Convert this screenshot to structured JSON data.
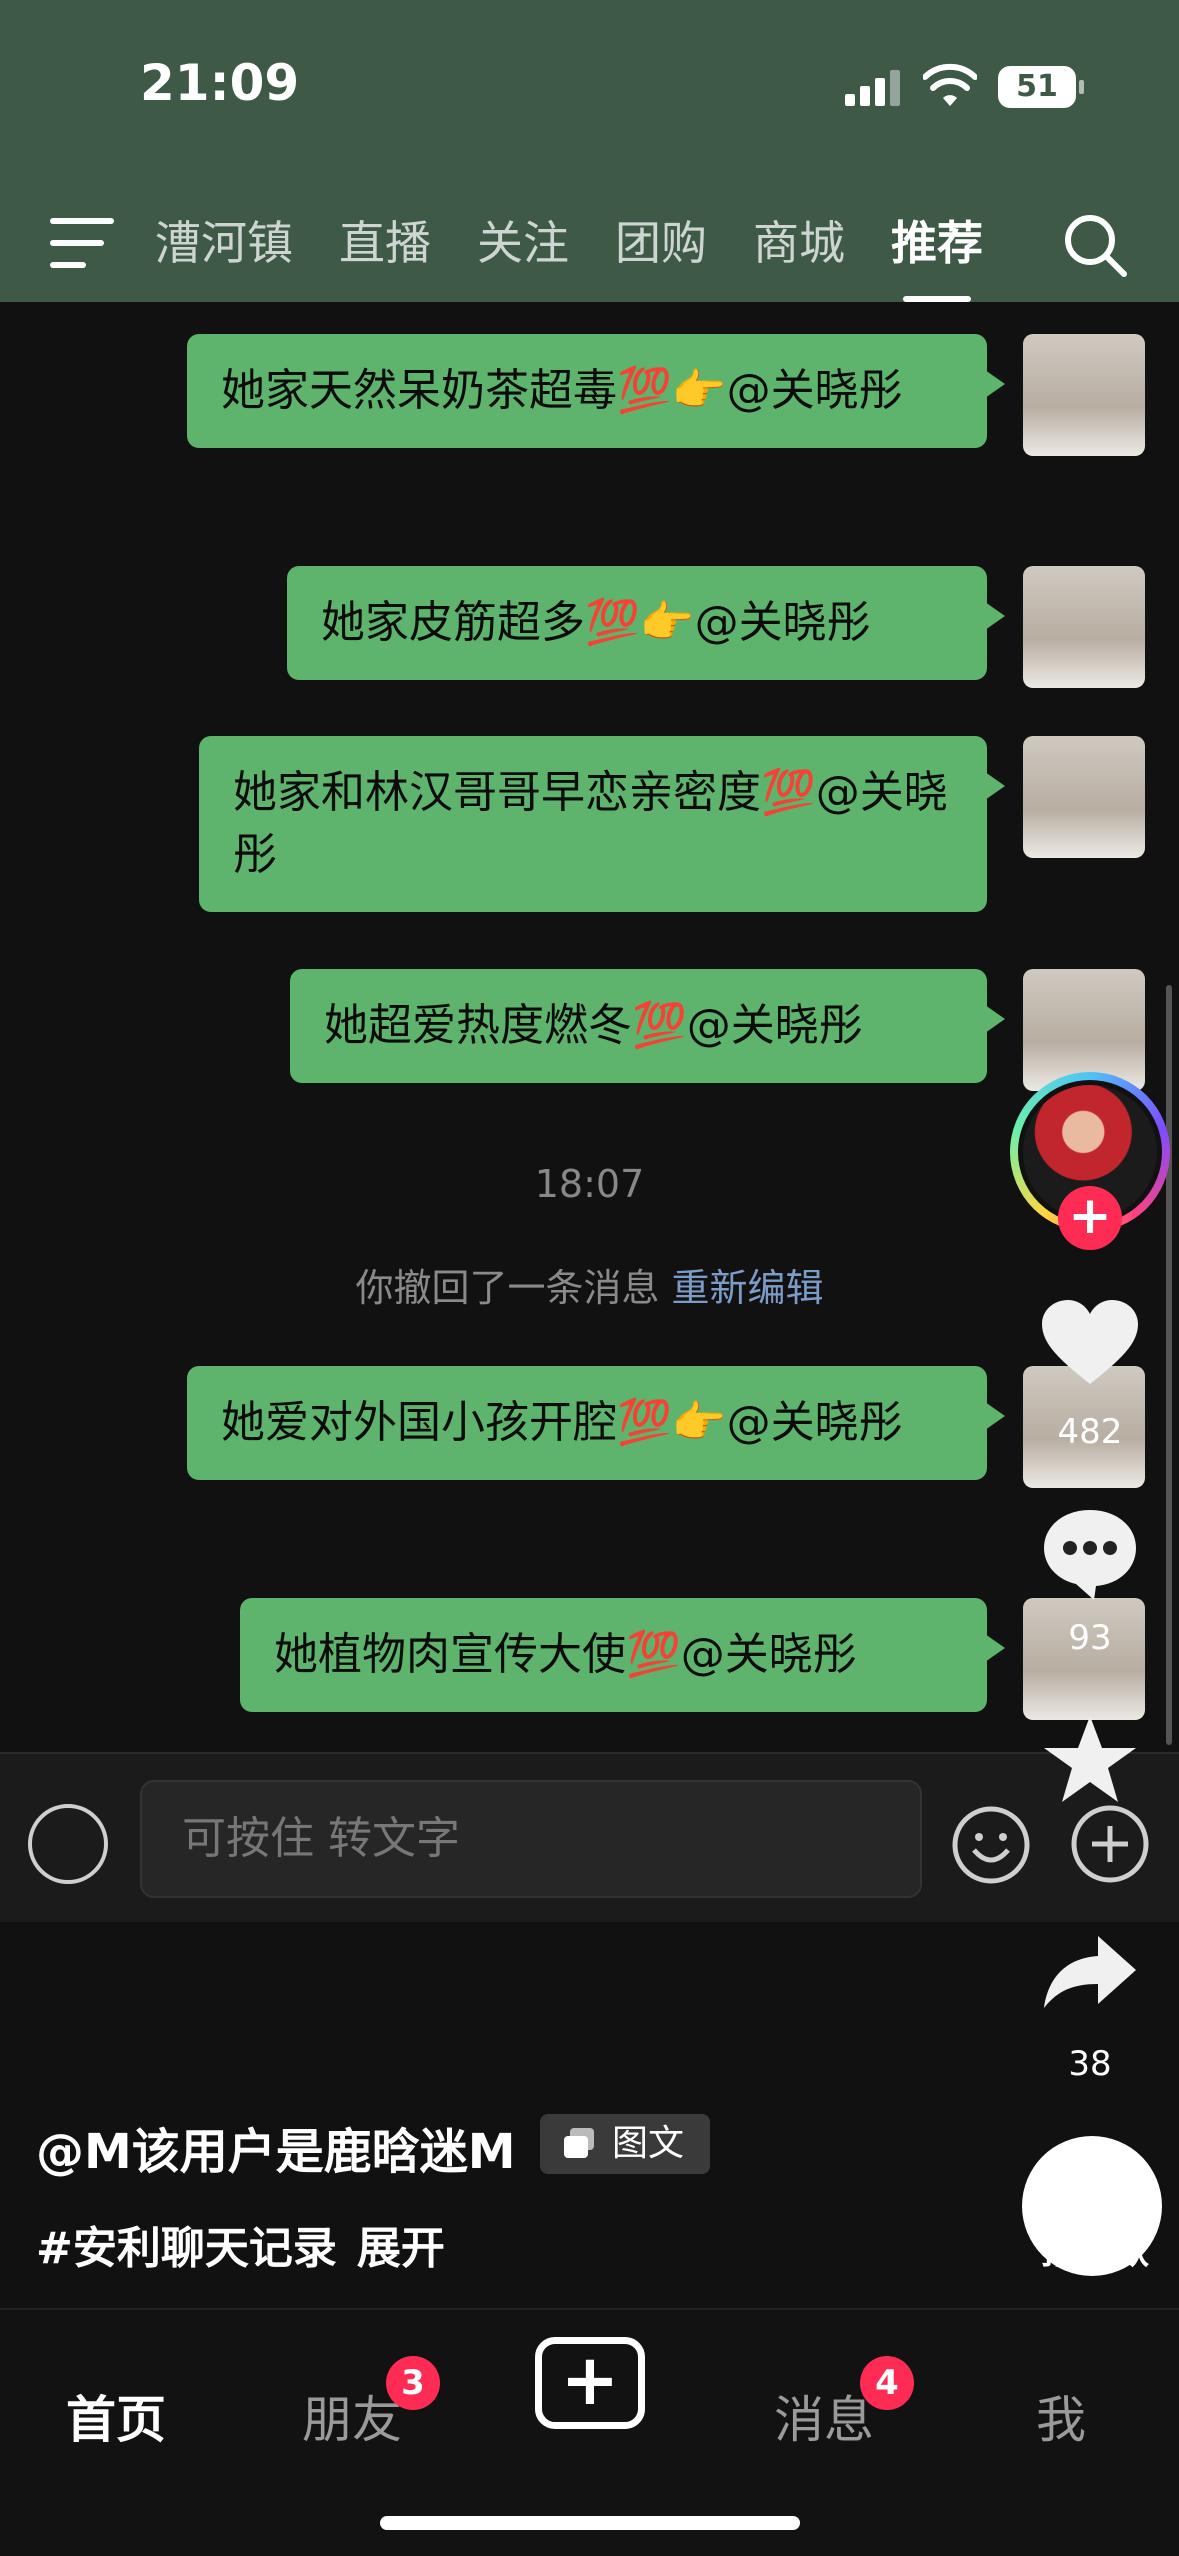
{
  "status": {
    "time": "21:09",
    "battery": "51"
  },
  "nav": {
    "tabs": [
      {
        "label": "漕河镇"
      },
      {
        "label": "直播"
      },
      {
        "label": "关注"
      },
      {
        "label": "团购"
      },
      {
        "label": "商城"
      },
      {
        "label": "推荐"
      }
    ],
    "active_tab": "推荐"
  },
  "chat": {
    "messages": [
      {
        "text": "她家天然呆奶茶超毒💯👉@关晓彤"
      },
      {
        "text": "她家皮筋超多💯👉@关晓彤"
      },
      {
        "text": "她家和林汉哥哥早恋亲密度💯@关晓彤"
      },
      {
        "text": "她超爱热度燃冬💯@关晓彤"
      },
      {
        "text": "她爱对外国小孩开腔💯👉@关晓彤"
      },
      {
        "text": "她植物肉宣传大使💯@关晓彤"
      }
    ],
    "timestamp": "18:07",
    "recall_text": "你撤回了一条消息",
    "recall_edit": "重新编辑"
  },
  "input": {
    "placeholder": "可按住 转文字"
  },
  "rail": {
    "likes": "482",
    "comments": "93",
    "shares": "38",
    "same_style_label": "拍同款"
  },
  "caption": {
    "user": "@M该用户是鹿晗迷M",
    "tag": "图文",
    "text": "#安利聊天记录",
    "expand": "展开"
  },
  "tabbar": {
    "home": "首页",
    "friends": "朋友",
    "friends_badge": "3",
    "messages": "消息",
    "messages_badge": "4",
    "me": "我"
  },
  "colors": {
    "bubble": "#5eb46d",
    "topbar": "#3f5947",
    "accent": "#fe2c55"
  }
}
